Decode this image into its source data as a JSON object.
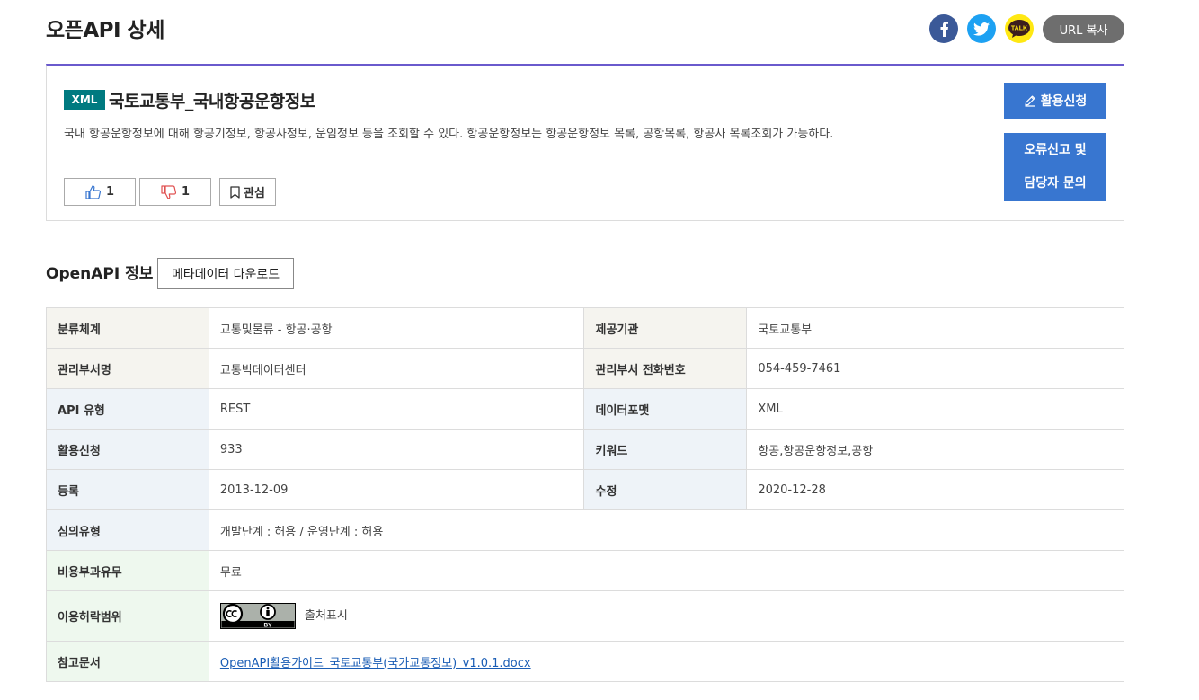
{
  "page": {
    "title": "오픈API 상세"
  },
  "share": {
    "facebook_icon": "facebook-icon",
    "twitter_icon": "twitter-icon",
    "kakaotalk_icon": "kakaotalk-icon",
    "kakao_label": "TALK",
    "url_copy_label": "URL 복사"
  },
  "detail": {
    "badge": "XML",
    "title": "국토교통부_국내항공운항정보",
    "description": "국내 항공운항정보에 대해 항공기정보, 항공사정보, 운임정보 등을 조회할 수 있다. 항공운항정보는 항공운항정보 목록, 공항목록, 항공사 목록조회가 가능하다.",
    "like_count": "1",
    "dislike_count": "1",
    "favorite_label": "관심",
    "apply_label": "활용신청",
    "report_line1": "오류신고 및",
    "report_line2": "담당자 문의"
  },
  "section": {
    "title": "OpenAPI 정보",
    "metadata_download_label": "메타데이터 다운로드"
  },
  "info": {
    "category_label": "분류체계",
    "category_value": "교통및물류 - 항공·공항",
    "provider_label": "제공기관",
    "provider_value": "국토교통부",
    "dept_label": "관리부서명",
    "dept_value": "교통빅데이터센터",
    "phone_label": "관리부서 전화번호",
    "phone_value": "054-459-7461",
    "api_type_label": "API 유형",
    "api_type_value": "REST",
    "format_label": "데이터포맷",
    "format_value": "XML",
    "apply_count_label": "활용신청",
    "apply_count_value": "933",
    "keyword_label": "키워드",
    "keyword_value": "항공,항공운항정보,공항",
    "reg_label": "등록",
    "reg_value": "2013-12-09",
    "mod_label": "수정",
    "mod_value": "2020-12-28",
    "review_label": "심의유형",
    "review_value": "개발단계 : 허용 / 운영단계 : 허용",
    "fee_label": "비용부과유무",
    "fee_value": "무료",
    "license_label": "이용허락범위",
    "license_value": "출처표시",
    "license_badge_text": "BY",
    "doc_label": "참고문서",
    "doc_value": "OpenAPI활용가이드_국토교통부(국가교통정보)_v1.0.1.docx"
  },
  "colors": {
    "accent_purple": "#6a5acd",
    "button_blue": "#3876d0",
    "badge_teal": "#007a80"
  }
}
